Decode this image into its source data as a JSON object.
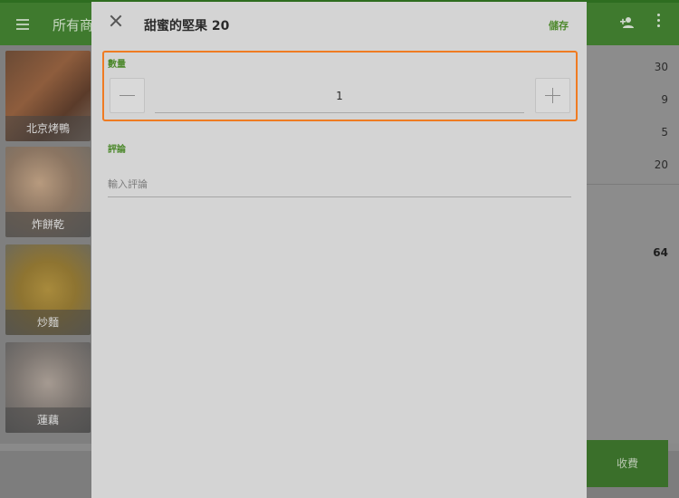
{
  "app": {
    "title": "所有商",
    "menu_items": [
      {
        "name": "北京烤鴨"
      },
      {
        "name": "炸餅乾"
      },
      {
        "name": "炒麵"
      },
      {
        "name": "蓮藕"
      }
    ],
    "order_quantities": [
      "30",
      "9",
      "5",
      "20"
    ],
    "order_total": "64",
    "charge_label": "收費",
    "icons": {
      "menu": "hamburger-icon",
      "add_person": "person-add-icon",
      "more": "more-vert-icon"
    }
  },
  "dialog": {
    "title": "甜蜜的堅果 20",
    "save_label": "儲存",
    "quantity": {
      "label": "數量",
      "value": "1"
    },
    "comment": {
      "label": "評論",
      "placeholder": "輸入評論",
      "value": ""
    },
    "icons": {
      "close": "close-icon",
      "minus": "minus-icon",
      "plus": "plus-icon"
    },
    "colors": {
      "accent": "#4f8a2f",
      "highlight": "#ef7b22"
    }
  }
}
